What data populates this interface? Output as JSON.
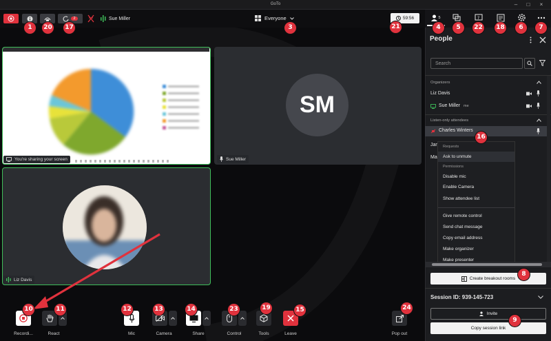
{
  "app": {
    "title": "GoTo"
  },
  "topbar": {
    "presenter_name": "Sue Miller",
    "audience_selector": "Everyone",
    "screens_count": "2",
    "timer": "59:56"
  },
  "tiles": {
    "share_label": "You're sharing your screen",
    "sue_label": "Sue Miller",
    "sue_initials": "SM",
    "liz_label": "Liz Davis"
  },
  "panel": {
    "tab_people_count": "5",
    "title": "People",
    "search_placeholder": "Search",
    "organizers_header": "Organizers",
    "org1": "Liz Davis",
    "org2": "Sue Miller",
    "org2_suffix": "me",
    "listen_header": "Listen-only attendees",
    "att1": "Charles Winters",
    "att2_partial": "Jan",
    "att3_partial": "Ma",
    "breakout_btn": "Create breakout rooms",
    "session_id": "Session ID: 939-145-723",
    "invite_btn": "Invite",
    "copy_link_btn": "Copy session link"
  },
  "context_menu": {
    "requests_header": "Requests",
    "ask_unmute": "Ask to unmute",
    "permissions_header": "Permissions",
    "disable_mic": "Disable mic",
    "enable_camera": "Enable Camera",
    "show_list": "Show attendee list",
    "remote_control": "Give remote control",
    "send_chat": "Send chat message",
    "copy_email": "Copy email address",
    "make_organizer": "Make organizer",
    "make_presenter": "Make presenter"
  },
  "bottom": {
    "record": "Recordi...",
    "react": "React",
    "mic": "Mic",
    "camera": "Camera",
    "share": "Share",
    "control": "Control",
    "tools": "Tools",
    "leave": "Leave",
    "popout": "Pop out"
  },
  "badges": {
    "b1": "1",
    "b3": "3",
    "b4": "4",
    "b5": "5",
    "b6": "6",
    "b7": "7",
    "b8": "8",
    "b9": "9",
    "b10": "10",
    "b11": "11",
    "b12": "12",
    "b13": "13",
    "b14": "14",
    "b15": "15",
    "b16": "16",
    "b17": "17",
    "b18": "18",
    "b19": "19",
    "b20": "20",
    "b21": "21",
    "b22": "22",
    "b23": "23",
    "b24": "24"
  },
  "colors": {
    "accent_red": "#e0323d",
    "tile_bg": "#2b2d31",
    "active_border": "#3fbf5a"
  }
}
